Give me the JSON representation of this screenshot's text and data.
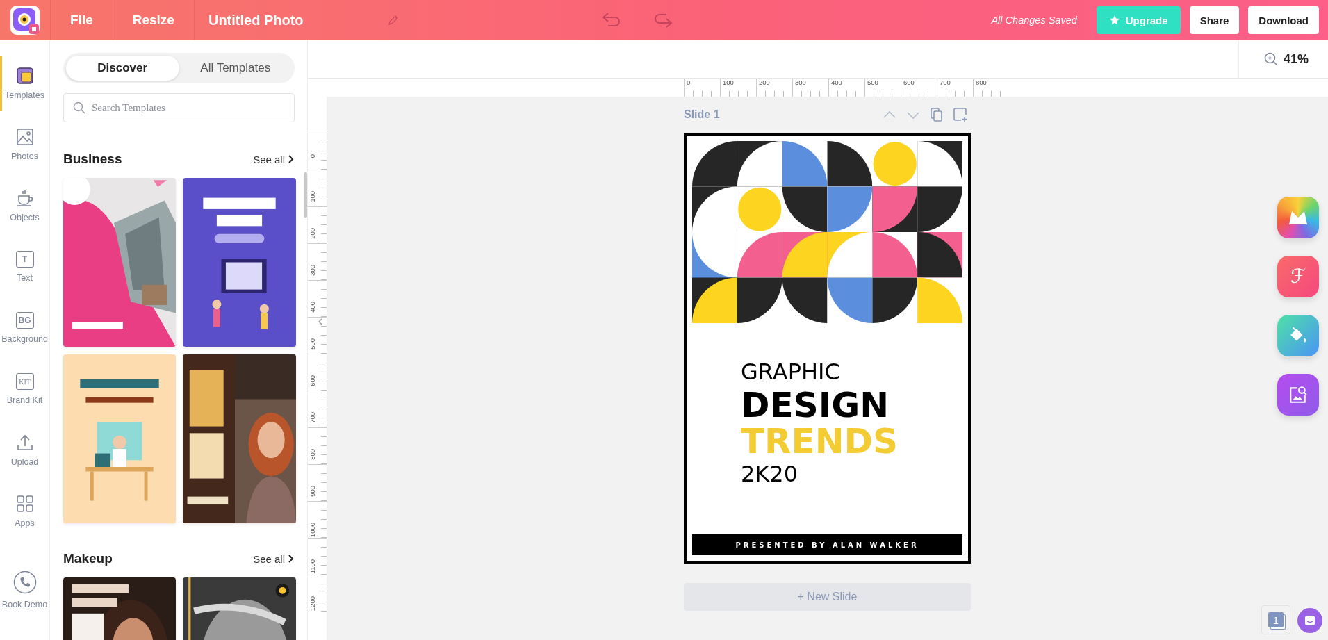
{
  "app_bar": {
    "menu": [
      "File",
      "Resize"
    ],
    "title": "Untitled Photo",
    "save_status": "All Changes Saved",
    "buttons": [
      {
        "label": "Upgrade",
        "kind": "upgrade"
      },
      {
        "label": "Share",
        "kind": "plain"
      },
      {
        "label": "Download",
        "kind": "plain"
      }
    ]
  },
  "sidebar": {
    "items": [
      {
        "label": "Templates",
        "selected": true
      },
      {
        "label": "Photos",
        "selected": false
      },
      {
        "label": "Objects",
        "selected": false
      },
      {
        "label": "Text",
        "selected": false,
        "icon_text": "T"
      },
      {
        "label": "Background",
        "selected": false,
        "icon_text": "BG"
      },
      {
        "label": "Brand Kit",
        "selected": false,
        "icon_text": "KIT"
      },
      {
        "label": "Upload",
        "selected": false
      },
      {
        "label": "Apps",
        "selected": false
      }
    ],
    "footer": "Book Demo"
  },
  "panel": {
    "tabs": [
      {
        "label": "Discover",
        "selected": true
      },
      {
        "label": "All Templates",
        "selected": false
      }
    ],
    "search": {
      "placeholder": "Search Templates"
    },
    "sections": [
      {
        "title": "Business",
        "link": "See all"
      },
      {
        "title": "Makeup",
        "link": "See all"
      }
    ]
  },
  "zoom": "41%",
  "rulers": {
    "horizontal": [
      "0",
      "100",
      "200",
      "300",
      "400",
      "500",
      "600",
      "700",
      "800"
    ],
    "vertical": [
      "0",
      "100",
      "200",
      "300",
      "400",
      "500",
      "600",
      "700",
      "800",
      "900",
      "1000",
      "1100",
      "1200"
    ]
  },
  "slide": {
    "label": "Slide 1",
    "design": {
      "lines": [
        {
          "text": "GRAPHIC",
          "kind": "light"
        },
        {
          "text": "DESIGN",
          "kind": "bold"
        },
        {
          "text": "TRENDS",
          "kind": "accent"
        },
        {
          "text": "2K20",
          "kind": "light"
        }
      ],
      "footer": "PRESENTED BY ALAN WALKER"
    }
  },
  "new_slide": "+ New Slide",
  "right_tools": [
    {
      "kind": "gallery"
    },
    {
      "kind": "font",
      "glyph": "ℱ"
    },
    {
      "kind": "paint"
    },
    {
      "kind": "image-search"
    }
  ],
  "page_count": "1"
}
